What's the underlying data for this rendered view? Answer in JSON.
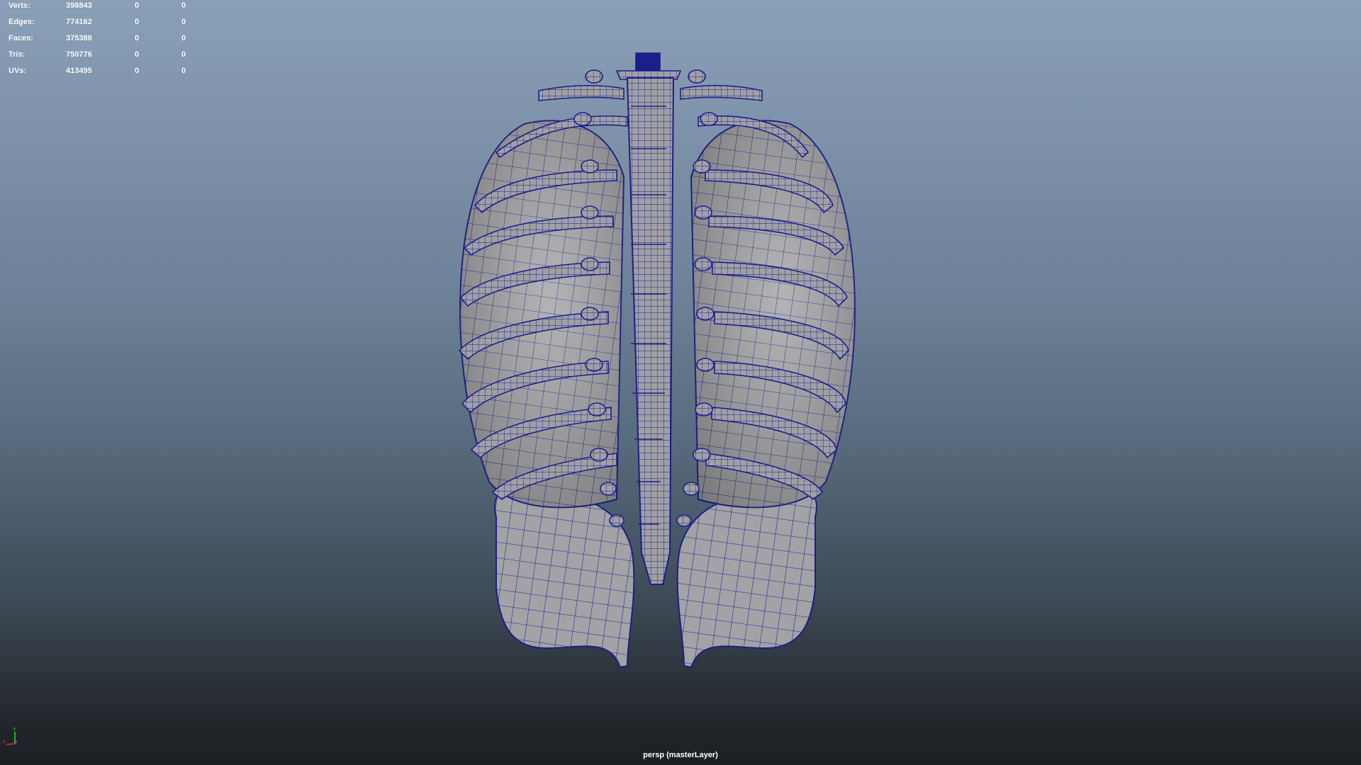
{
  "hud": {
    "rows": [
      {
        "label": "Verts:",
        "total": "398843",
        "sel1": "0",
        "sel2": "0"
      },
      {
        "label": "Edges:",
        "total": "774162",
        "sel1": "0",
        "sel2": "0"
      },
      {
        "label": "Faces:",
        "total": "375388",
        "sel1": "0",
        "sel2": "0"
      },
      {
        "label": "Tris:",
        "total": "750776",
        "sel1": "0",
        "sel2": "0"
      },
      {
        "label": "UVs:",
        "total": "413495",
        "sel1": "0",
        "sel2": "0"
      }
    ]
  },
  "viewport": {
    "camera_label": "persp (masterLayer)",
    "display_mode": "wireframe-on-shaded",
    "wire_color": "#1c1e8a",
    "shade_color": "#a3a3a6",
    "axis_gizmo": {
      "x_label": "x",
      "y_label": "Y",
      "x_color": "#d23a3a",
      "y_color": "#3fcf4a",
      "z_color": "#3a63d2"
    }
  }
}
